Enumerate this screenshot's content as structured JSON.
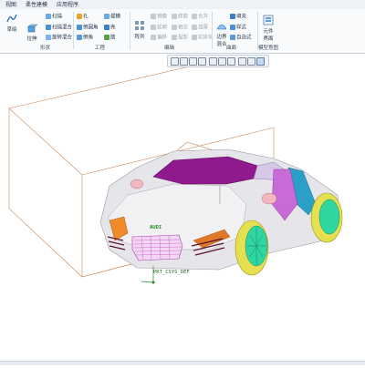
{
  "tabs": [
    "视图",
    "柔性建模",
    "应用程序"
  ],
  "ribbon": {
    "sketch_label": "草绘",
    "extrude_label": "拉伸",
    "shape_group_label": "形状",
    "engineering_group_label": "工程",
    "editing_group_label": "编辑",
    "surface_group_label": "曲面",
    "model_intent_group_label": "模型意图",
    "hole_label": "孔",
    "round_label": "倒圆角",
    "chamfer_label": "倒角",
    "draft_label": "拔模",
    "shell_label": "壳",
    "rib_label": "筋",
    "sweep_label": "扫描",
    "helical_label": "扫描混合",
    "blend_label": "旋转混合",
    "pattern_label": "阵列",
    "mirror_label": "镜像",
    "extend_label": "延伸",
    "trim_label": "修剪",
    "merge_label": "合并",
    "offset_label": "偏移",
    "thicken_label": "加厚",
    "intersect_label": "相交",
    "project_label": "投影",
    "solidify_label": "实体化",
    "fill_label": "填充",
    "style_label": "样式",
    "freestyle_label": "自由式",
    "boundary_label": "边界混合",
    "family_table_label": "元件界面",
    "model_tree_group_label": "模型意图"
  },
  "viewport": {
    "datum_label": "PRT_CSYS_DEF",
    "badge_text": "AUDI",
    "datum_color": "#2a8a2a",
    "accent_colors": {
      "body": "#e9e9ec",
      "roof": "#8e1a8e",
      "side_panel": "#2a9fc8",
      "door": "#c86bd6",
      "wheel": "#2fd6a0",
      "tire_ring": "#e5e050",
      "grille": "#e070d8",
      "headlight": "#f08a2a",
      "mirror": "#f2b7bf",
      "bbox": "#c98a5a"
    }
  }
}
